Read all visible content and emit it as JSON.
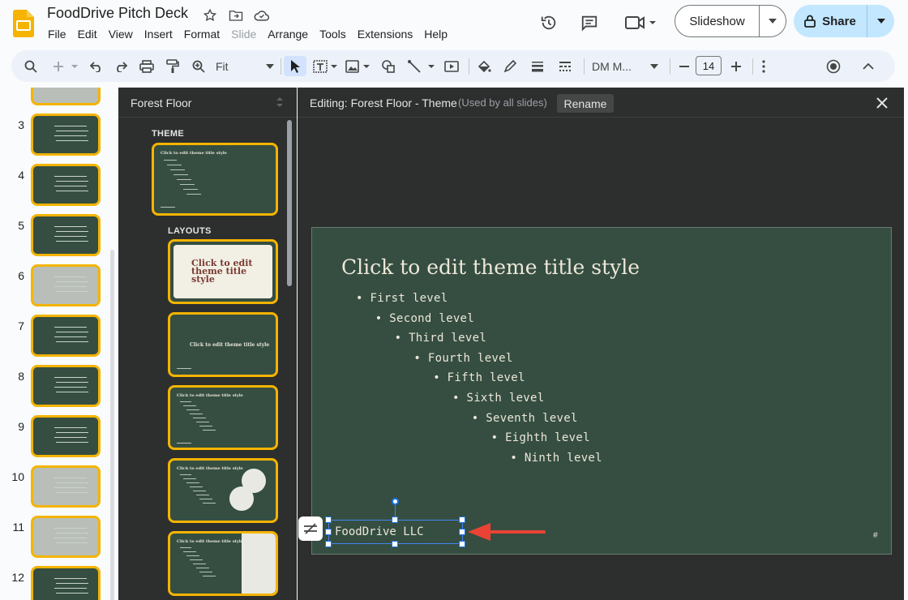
{
  "app": {
    "doc_title": "FoodDrive Pitch Deck",
    "menu": [
      "File",
      "Edit",
      "View",
      "Insert",
      "Format",
      "Slide",
      "Arrange",
      "Tools",
      "Extensions",
      "Help"
    ],
    "disabled_menu": "Slide",
    "slideshow_label": "Slideshow",
    "share_label": "Share",
    "accent": "#c2e7ff"
  },
  "toolbar": {
    "zoom": "Fit",
    "font": "DM M...",
    "font_size": "14",
    "icons": [
      "search-icon",
      "add-icon",
      "undo-icon",
      "redo-icon",
      "print-icon",
      "paint-format-icon",
      "zoom-icon",
      "select-icon",
      "text-box-icon",
      "image-icon",
      "shape-icon",
      "line-icon",
      "video-icon",
      "fill-color-icon",
      "border-color-icon",
      "border-weight-icon",
      "border-dash-icon",
      "more-icon",
      "record-icon",
      "collapse-icon"
    ]
  },
  "filmstrip": {
    "slides": [
      {
        "num": "3",
        "light": false
      },
      {
        "num": "4",
        "light": false
      },
      {
        "num": "5",
        "light": false
      },
      {
        "num": "6",
        "light": true
      },
      {
        "num": "7",
        "light": false
      },
      {
        "num": "8",
        "light": false
      },
      {
        "num": "9",
        "light": false
      },
      {
        "num": "10",
        "light": true
      },
      {
        "num": "11",
        "light": true
      },
      {
        "num": "12",
        "light": false
      }
    ]
  },
  "layout_panel": {
    "title": "Forest Floor",
    "theme_heading": "THEME",
    "layouts_heading": "LAYOUTS",
    "theme_thumb_title": "Click to edit theme title style",
    "layout_title_a": "Click to edit theme title style",
    "layout_title_b": "Click to edit theme title style",
    "layout_title_c": "Click to edit theme title style",
    "layout_title_d": "Click to edit theme title style",
    "layout_title_light": "Click to edit theme title style"
  },
  "editor": {
    "title": "Editing: Forest Floor - Theme",
    "subtitle": "(Used by all slides)",
    "rename_label": "Rename"
  },
  "slide": {
    "title": "Click to edit theme title style",
    "bullets": [
      "First level",
      "Second level",
      "Third level",
      "Fourth level",
      "Fifth level",
      "Sixth level",
      "Seventh level",
      "Eighth level",
      "Ninth level"
    ],
    "footer": "FoodDrive LLC",
    "slide_number": "#",
    "background": "#354e41",
    "text_color": "#ece7d8",
    "arrow_color": "#ea4335"
  }
}
